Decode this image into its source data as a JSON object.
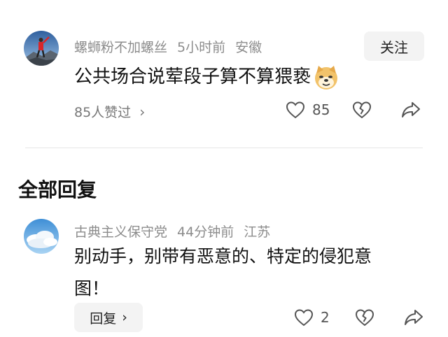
{
  "post": {
    "author": "螺蛳粉不加螺丝",
    "time": "5小时前",
    "location": "安徽",
    "follow_label": "关注",
    "content": "公共场合说荤段子算不算猥亵",
    "emoji": "doge-emoji",
    "likers_text": "85人赞过",
    "like_count": "85",
    "icons": [
      "chevron-right-icon",
      "heart-icon",
      "broken-heart-icon",
      "share-icon"
    ]
  },
  "section": {
    "title": "全部回复"
  },
  "reply": {
    "author": "古典主义保守党",
    "time": "44分钟前",
    "location": "江苏",
    "content_line1": "别动手，别带有恶意的、特定的侵犯意",
    "content_line2": "图！",
    "reply_label": "回复",
    "like_count": "2"
  },
  "colors": {
    "meta_text": "#8c8c8c",
    "button_bg": "#f3f3f3",
    "divider": "#e6e6e6"
  }
}
